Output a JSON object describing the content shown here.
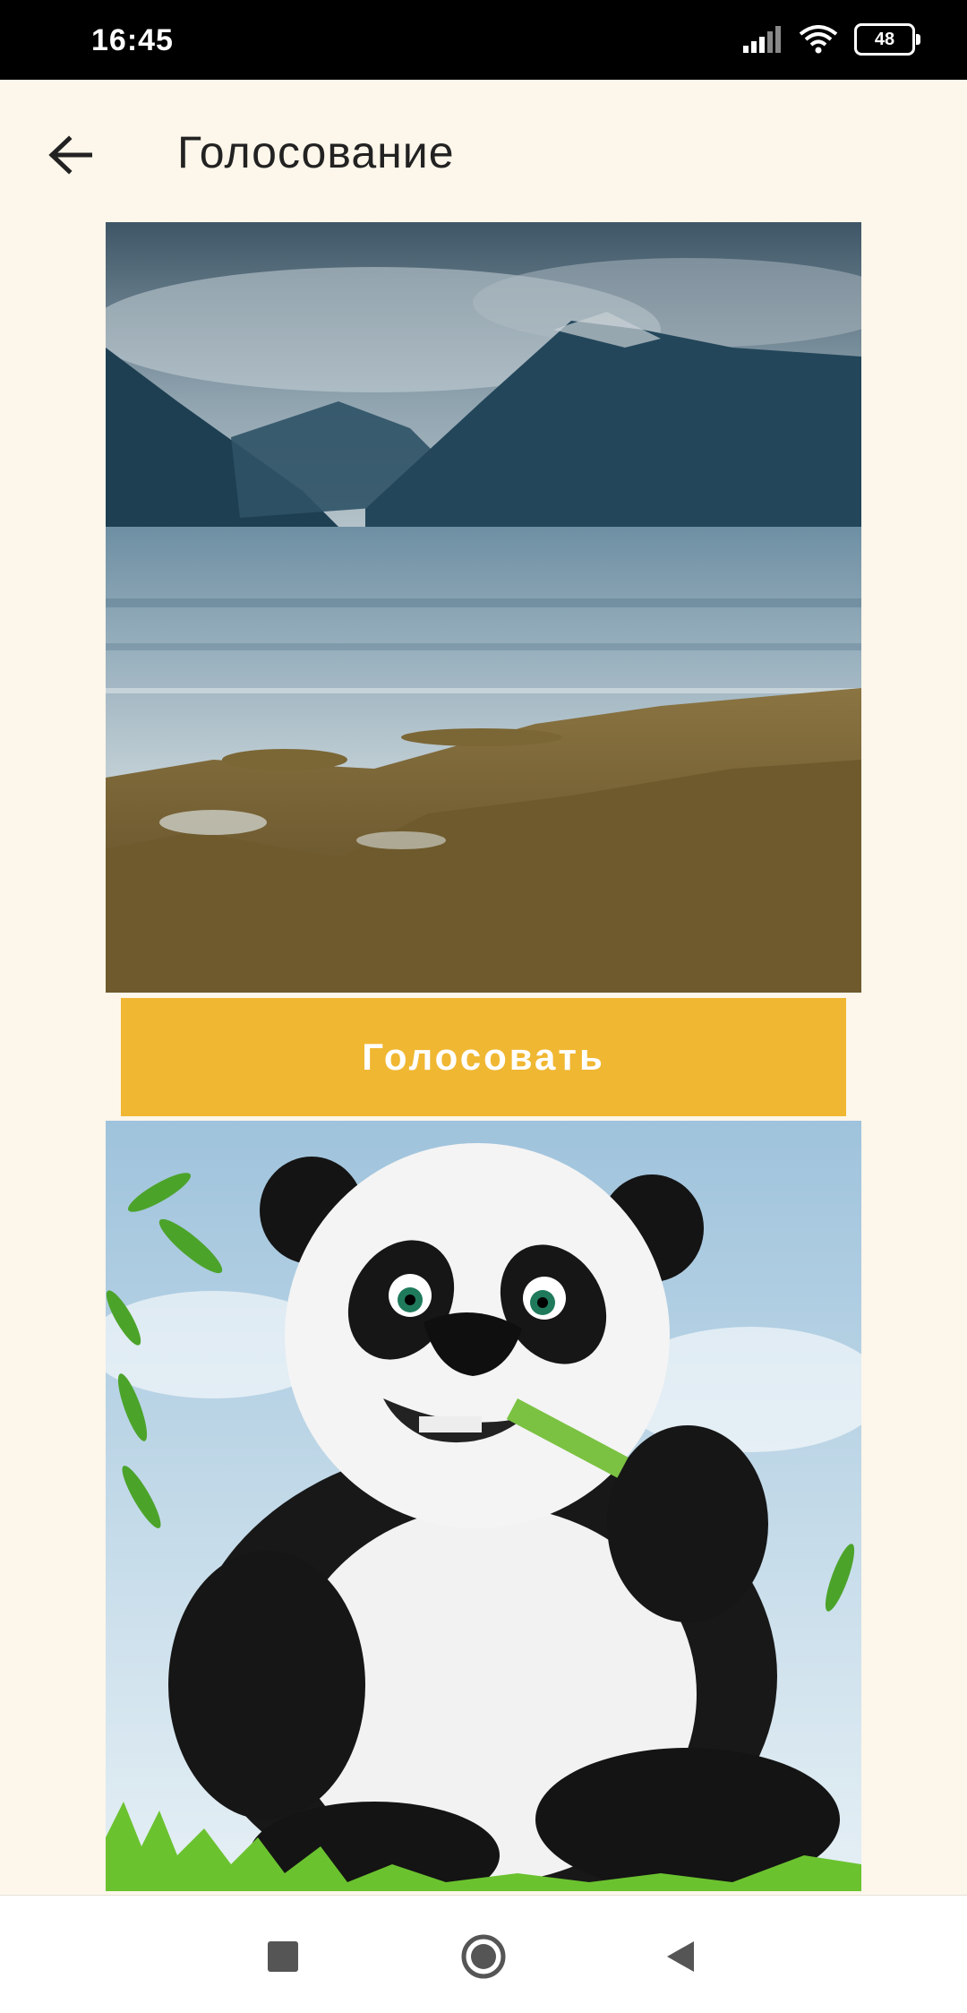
{
  "status_bar": {
    "time": "16:45",
    "battery": "48",
    "icons": [
      "signal-icon",
      "wifi-icon",
      "battery-icon"
    ]
  },
  "app_bar": {
    "title": "Голосование",
    "back_icon": "arrow-left-icon"
  },
  "candidates": [
    {
      "image": "landscape-photo",
      "vote_label": "Голосовать"
    },
    {
      "image": "panda-photo"
    }
  ],
  "nav_bar": {
    "icons": [
      "recents-square-icon",
      "home-circle-icon",
      "back-triangle-icon"
    ]
  },
  "colors": {
    "background": "#FDF6EA",
    "accent": "#F0B732",
    "status_bar": "#000000"
  }
}
